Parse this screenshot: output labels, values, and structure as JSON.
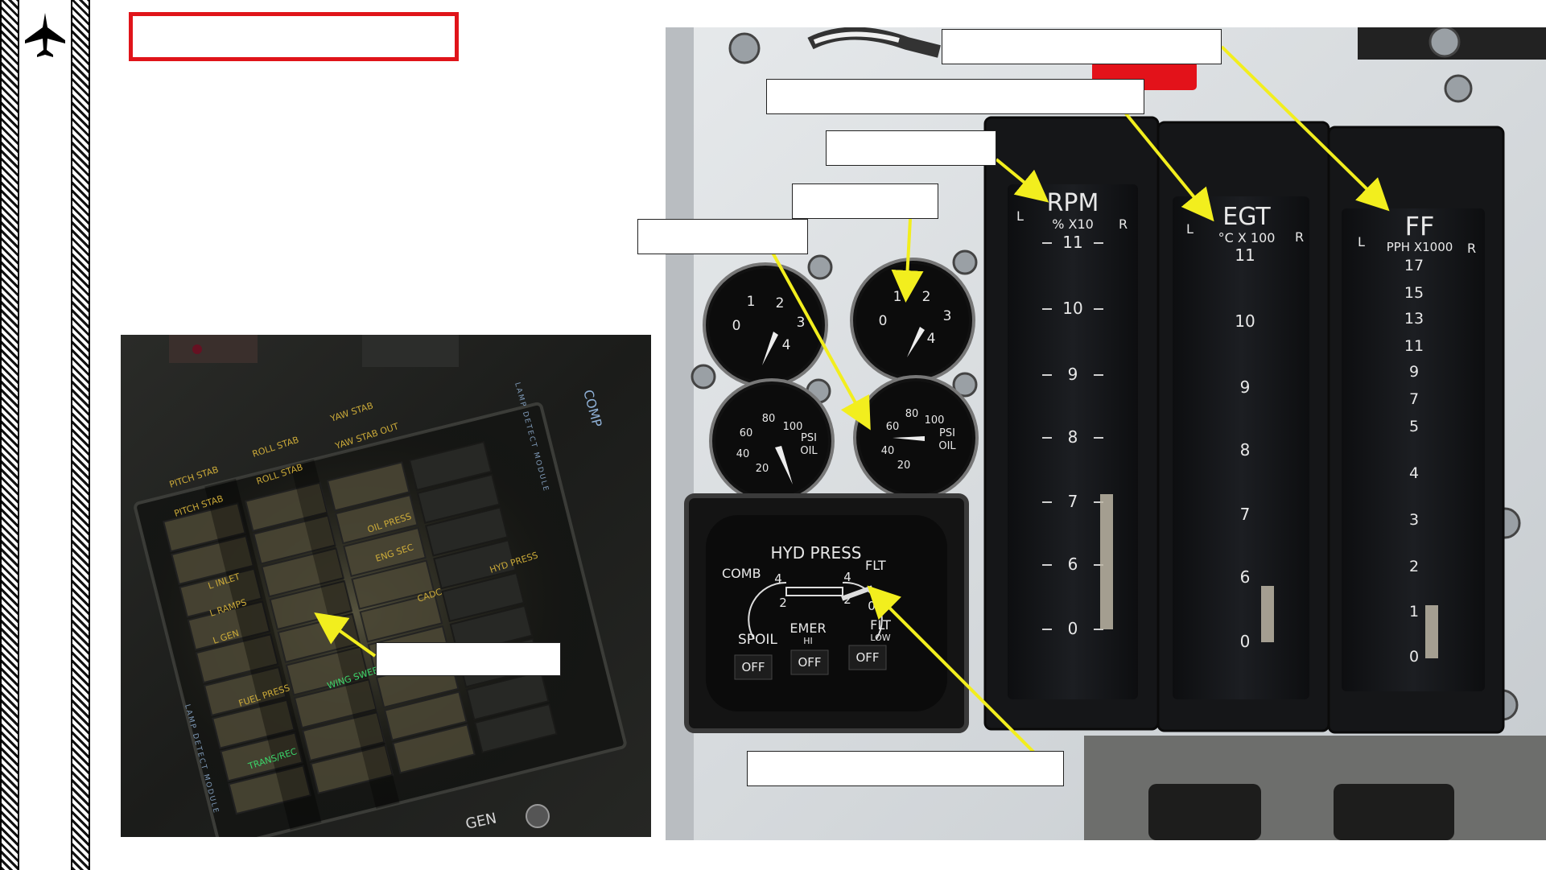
{
  "slide": {
    "title_box": "",
    "logo_icon": "jet-silhouette-icon"
  },
  "caution_panel": {
    "lights": [
      "PITCH STAB",
      "PITCH STAB",
      "ROLL STAB",
      "ROLL STAB",
      "YAW STAB",
      "YAW STAB OUT",
      "L INLET",
      "L RAMPS",
      "L GEN",
      "OIL PRESS",
      "ENG SEC",
      "CADC",
      "HYD PRESS",
      "FUEL PRESS",
      "WING SWEEP",
      "TRANS/REC"
    ],
    "side_text_left": "LAMP DETECT MODULE",
    "side_text_right": "LAMP DETECT MODULE",
    "comp_label": "COMP",
    "gen_label": "GEN",
    "callout": ""
  },
  "engine_gauges": {
    "rpm": {
      "title": "RPM",
      "unit": "% X10",
      "left": "L",
      "right": "R",
      "ticks": [
        "11",
        "10",
        "9",
        "8",
        "7",
        "6",
        "0"
      ]
    },
    "egt": {
      "title": "EGT",
      "unit": "°C X 100",
      "left": "L",
      "right": "R",
      "ticks": [
        "11",
        "10",
        "9",
        "8",
        "7",
        "6",
        "0"
      ]
    },
    "ff": {
      "title": "FF",
      "unit": "PPH X1000",
      "left": "L",
      "right": "R",
      "ticks": [
        "17",
        "15",
        "13",
        "11",
        "9",
        "7",
        "5",
        "4",
        "3",
        "2",
        "1",
        "0"
      ]
    }
  },
  "round_gauges": {
    "small_dial_ticks": [
      "0",
      "1",
      "2",
      "3",
      "4"
    ],
    "oil_dial_ticks": [
      "20",
      "40",
      "60",
      "80",
      "100"
    ],
    "oil_label_1": "PSI",
    "oil_label_2": "OIL"
  },
  "hyd_panel": {
    "title": "HYD PRESS",
    "comb": "COMB",
    "flt": "FLT",
    "spoil": "SPOIL",
    "emer": "EMER",
    "emer_sub": "HI",
    "flt_low": "FLT",
    "flt_low_sub": "LOW",
    "flags": [
      "OFF",
      "OFF",
      "OFF"
    ],
    "dial_ticks": [
      "4",
      "2",
      "0"
    ]
  },
  "callouts": {
    "ff_label": "",
    "egt_label": "",
    "rpm_label": "",
    "nozzle_label": "",
    "oil_label": "",
    "hyd_label": ""
  },
  "colors": {
    "arrow": "#f2ee1e",
    "frame": "#e0141a"
  }
}
